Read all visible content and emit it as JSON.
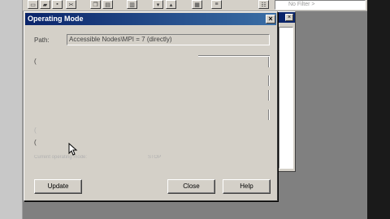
{
  "background_app": {
    "filter_placeholder": "No Filter >",
    "toolbar_icons": [
      "new-icon",
      "open-icon",
      "save-icon",
      "cut-icon",
      "copy-icon",
      "paste-icon",
      "paste-icon",
      "download-icon",
      "upload-icon",
      "properties-icon",
      "list-icon",
      "details-icon"
    ]
  },
  "dialog": {
    "title": "Operating Mode",
    "path_label": "Path:",
    "path_value": "Accessible Nodes\\MPI =  7 (directly)",
    "obscured_fragments": [
      "(",
      "(",
      "("
    ],
    "faint_label": "Current operating mode:",
    "faint_value": "STOP",
    "buttons": {
      "update": "Update",
      "close": "Close",
      "help": "Help"
    }
  }
}
